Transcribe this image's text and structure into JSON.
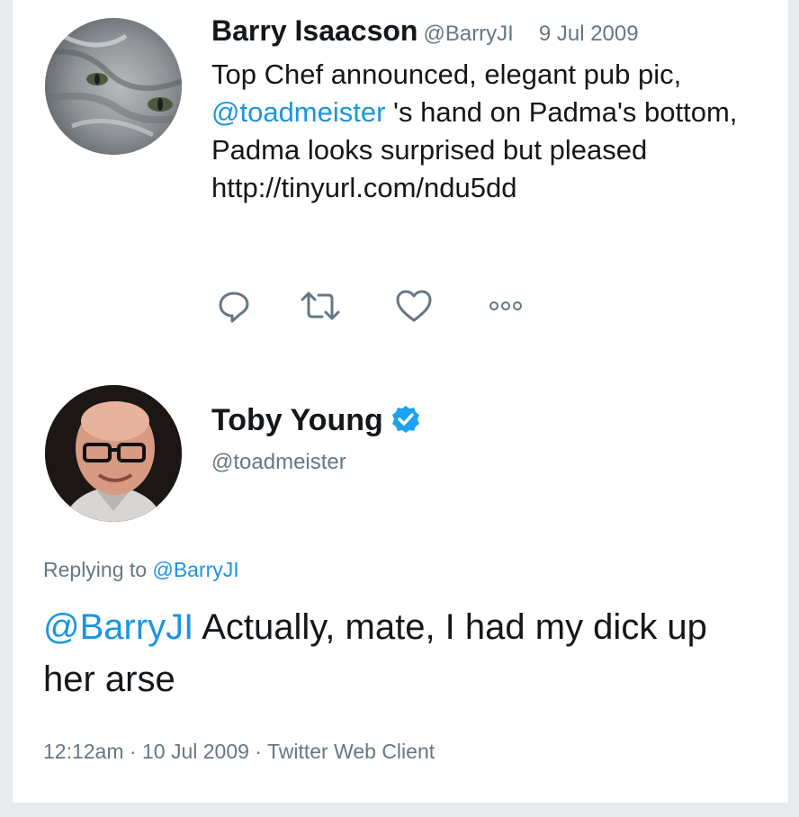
{
  "tweet1": {
    "author_name": "Barry Isaacson",
    "author_handle": "@BarryJI",
    "date": "9 Jul 2009",
    "text_before": "Top Chef announced, elegant pub pic, ",
    "mention": "@toadmeister",
    "text_after": " 's hand  on Padma's bottom, Padma looks surprised but pleased http://tinyurl.com/ndu5dd",
    "actions": [
      "reply-icon",
      "retweet-icon",
      "like-icon",
      "more-icon"
    ]
  },
  "tweet2": {
    "author_name": "Toby Young",
    "author_handle": "@toadmeister",
    "verified_icon": "verified-badge-icon",
    "replying_to_label": "Replying to ",
    "replying_to_handle": "@BarryJI",
    "text_mention": "@BarryJI",
    "text_body": " Actually, mate, I had my dick up her arse",
    "time": "12:12am",
    "separator": " · ",
    "date": "10 Jul 2009",
    "client": "Twitter Web Client"
  },
  "colors": {
    "link": "#1b95e0",
    "secondary_text": "#657786",
    "primary_text": "#14171a",
    "verified": "#1da1f2"
  }
}
